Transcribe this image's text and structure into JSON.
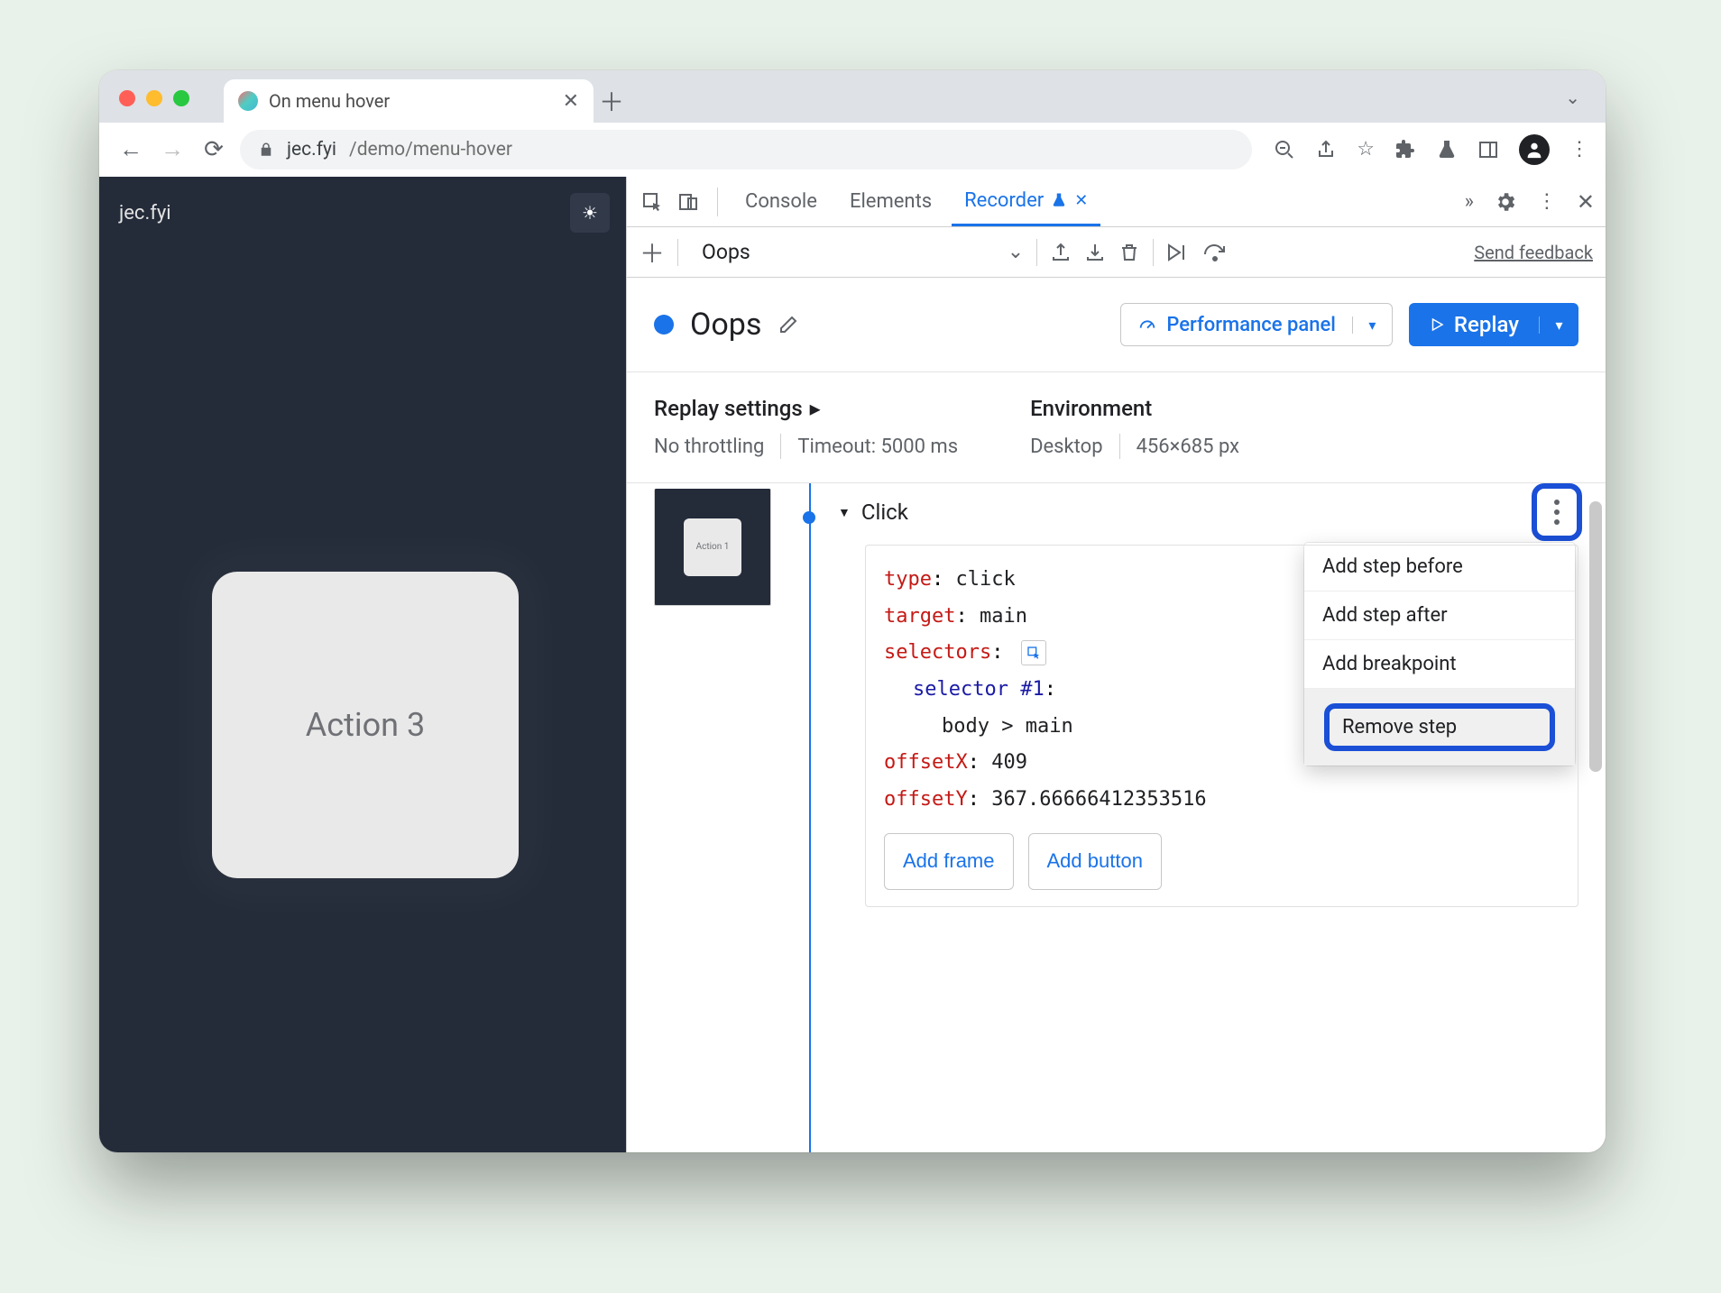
{
  "browser": {
    "tab_title": "On menu hover",
    "url_host": "jec.fyi",
    "url_path": "/demo/menu-hover"
  },
  "page": {
    "site_title": "jec.fyi",
    "card_label": "Action 3",
    "thumb_label": "Action 1"
  },
  "devtools": {
    "tabs": {
      "console": "Console",
      "elements": "Elements",
      "recorder": "Recorder"
    },
    "recording_name": "Oops",
    "feedback": "Send feedback",
    "perf_panel": "Performance panel",
    "replay": "Replay",
    "settings": {
      "replay_title": "Replay settings",
      "throttling": "No throttling",
      "timeout": "Timeout: 5000 ms",
      "env_title": "Environment",
      "env_device": "Desktop",
      "env_size": "456×685 px"
    },
    "step": {
      "title": "Click",
      "type_k": "type",
      "type_v": "click",
      "target_k": "target",
      "target_v": "main",
      "selectors_k": "selectors",
      "selector_label": "selector #1",
      "selector_val": "body > main",
      "offx_k": "offsetX",
      "offx_v": "409",
      "offy_k": "offsetY",
      "offy_v": "367.66666412353516",
      "add_frame": "Add frame",
      "add_button": "Add button"
    },
    "ctx": {
      "before": "Add step before",
      "after": "Add step after",
      "bp": "Add breakpoint",
      "remove": "Remove step"
    }
  }
}
